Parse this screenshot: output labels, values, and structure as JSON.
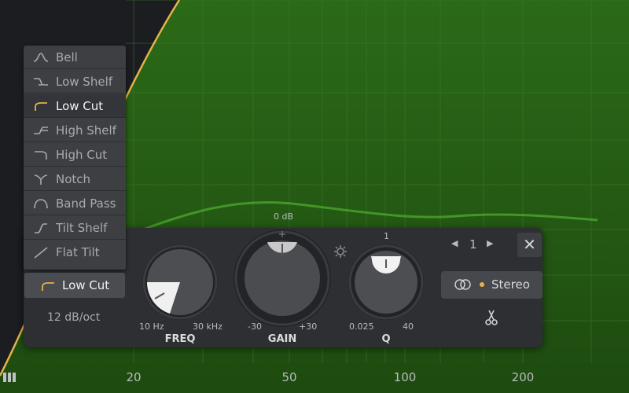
{
  "frequency_axis": {
    "labels": [
      {
        "text": "20",
        "hz": 20
      },
      {
        "text": "50",
        "hz": 50
      },
      {
        "text": "100",
        "hz": 100
      },
      {
        "text": "200",
        "hz": 200
      }
    ]
  },
  "filter_shape_menu": {
    "items": [
      {
        "label": "Bell",
        "icon": "bell-shape-icon"
      },
      {
        "label": "Low Shelf",
        "icon": "low-shelf-icon"
      },
      {
        "label": "Low Cut",
        "icon": "low-cut-icon",
        "selected": true
      },
      {
        "label": "High Shelf",
        "icon": "high-shelf-icon"
      },
      {
        "label": "High Cut",
        "icon": "high-cut-icon"
      },
      {
        "label": "Notch",
        "icon": "notch-icon"
      },
      {
        "label": "Band Pass",
        "icon": "band-pass-icon"
      },
      {
        "label": "Tilt Shelf",
        "icon": "tilt-shelf-icon"
      },
      {
        "label": "Flat Tilt",
        "icon": "flat-tilt-icon"
      }
    ]
  },
  "band_panel": {
    "shape_select": "Low Cut",
    "slope": "12 dB/oct",
    "freq": {
      "label": "FREQ",
      "min": "10 Hz",
      "max": "30 kHz"
    },
    "gain": {
      "label": "GAIN",
      "min": "-30",
      "max": "+30",
      "top_label": "0 dB"
    },
    "q": {
      "label": "Q",
      "min": "0.025",
      "max": "40",
      "top_label": "1"
    },
    "band_number": "1",
    "stereo_label": "Stereo"
  },
  "colors": {
    "accent": "#e6b24a",
    "spectrum_green": "#2e6a1a",
    "panel_bg": "#2d2f33"
  }
}
